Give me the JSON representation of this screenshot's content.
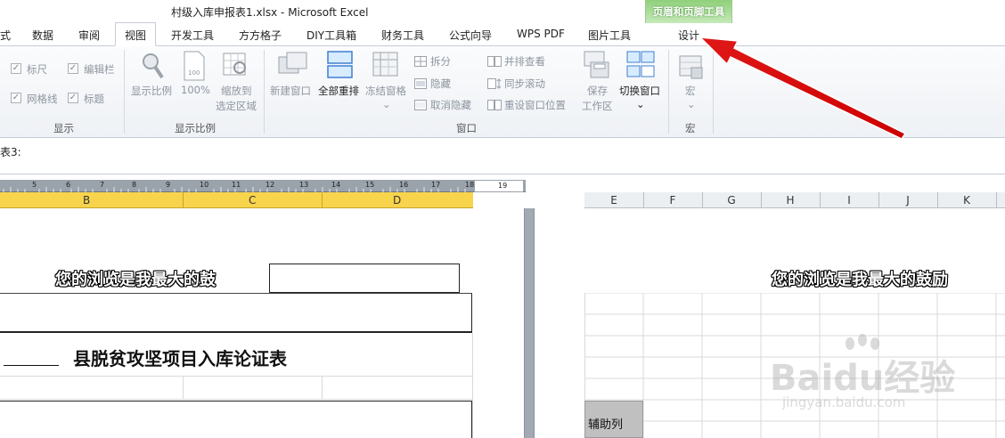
{
  "window": {
    "title": "村级入库申报表1.xlsx  -  Microsoft Excel",
    "context_tab": "页眉和页脚工具"
  },
  "tabs": [
    "式",
    "数据",
    "审阅",
    "视图",
    "开发工具",
    "方方格子",
    "DIY工具箱",
    "财务工具",
    "公式向导",
    "WPS PDF",
    "图片工具",
    "设计"
  ],
  "active_tab": "视图",
  "ribbon": {
    "show": {
      "ruler": "标尺",
      "edit_bar": "编辑栏",
      "gridlines": "网格线",
      "headings": "标题",
      "label": "显示"
    },
    "zoom": {
      "zoom": "显示比例",
      "hundred": "100%",
      "zoom_sel_1": "缩放到",
      "zoom_sel_2": "选定区域",
      "label": "显示比例"
    },
    "window": {
      "new": "新建窗口",
      "arrange": "全部重排",
      "freeze": "冻结窗格",
      "split": "拆分",
      "hide": "隐藏",
      "unhide": "取消隐藏",
      "side": "并排查看",
      "sync": "同步滚动",
      "reset": "重设窗口位置",
      "save_1": "保存",
      "save_2": "工作区",
      "switch": "切换窗口",
      "label": "窗口"
    },
    "macro": {
      "macro": "宏",
      "label": "宏"
    }
  },
  "formula_bar": {
    "cell_ref": "表3:"
  },
  "ruler_numbers": [
    "5",
    "6",
    "7",
    "8",
    "9",
    "10",
    "11",
    "12",
    "13",
    "14",
    "15",
    "16",
    "17",
    "18",
    "19"
  ],
  "col_headers_left": [
    "B",
    "C",
    "D"
  ],
  "col_headers_right": [
    "E",
    "F",
    "G",
    "H",
    "I",
    "J",
    "K"
  ],
  "sheet": {
    "banner_text": "您的浏览是我最大的鼓",
    "banner_text_right": "您的浏览是我最大的鼓励",
    "heading": "县脱贫攻坚项目入库论证表",
    "helper_col": "辅助列"
  },
  "watermark": {
    "brand": "Baidu经验",
    "url": "jingyan.baidu.com"
  }
}
